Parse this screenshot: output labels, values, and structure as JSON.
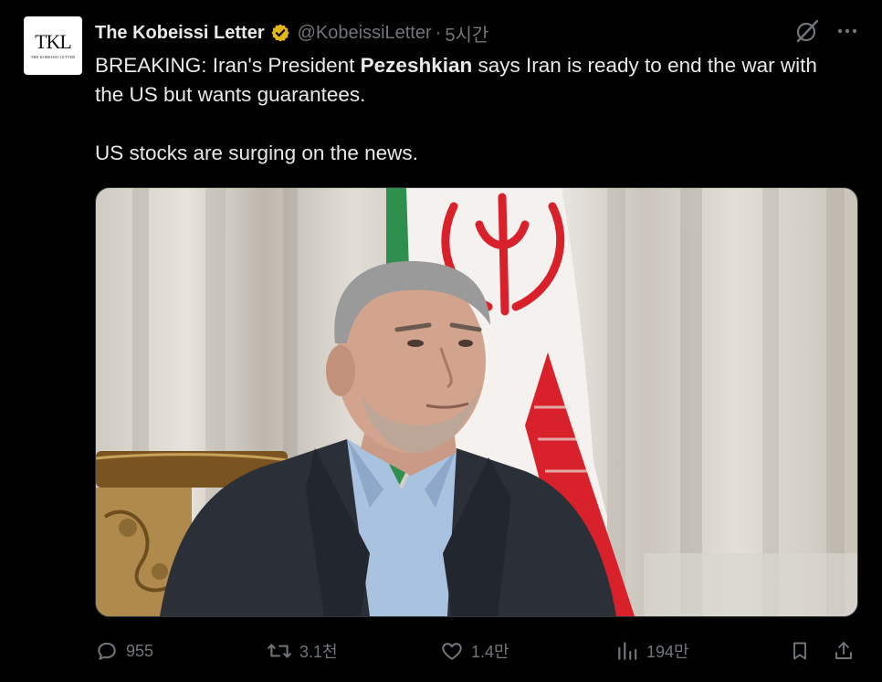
{
  "tweet": {
    "author_name": "The Kobeissi Letter",
    "avatar_text": "TKL",
    "avatar_subtext": "THE KOBEISSI LETTER",
    "handle": "@KobeissiLetter",
    "separator": "·",
    "time": "5시간",
    "text_line1_prefix": "BREAKING: Iran's President ",
    "text_line1_bold": "Pezeshkian",
    "text_line1_suffix": " says Iran is ready to end the war with the US but wants guarantees.",
    "text_para2": "US stocks are surging on the news."
  },
  "actions": {
    "replies": "955",
    "reposts": "3.1천",
    "likes": "1.4만",
    "views": "194만"
  },
  "icons": {
    "verified": "verified-badge-icon",
    "grok": "grok-icon",
    "more": "more-icon",
    "reply": "reply-icon",
    "repost": "repost-icon",
    "like": "heart-icon",
    "views": "views-icon",
    "bookmark": "bookmark-icon",
    "share": "share-icon"
  },
  "colors": {
    "background": "#000000",
    "text": "#e7e9ea",
    "muted": "#71767b",
    "verified_gold": "#e2b719"
  }
}
